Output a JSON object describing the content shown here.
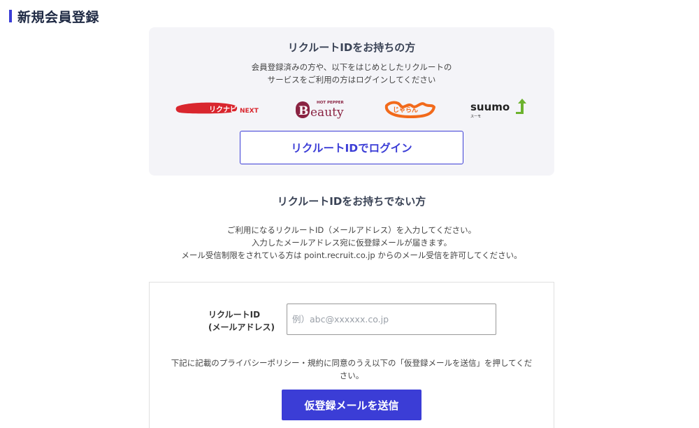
{
  "page": {
    "heading": "新規会員登録"
  },
  "login_section": {
    "title": "リクルートIDをお持ちの方",
    "description_line1": "会員登録済みの方や、以下をはじめとしたリクルートの",
    "description_line2": "サービスをご利用の方はログインしてください",
    "logos": [
      {
        "name": "rikunabi-next-logo",
        "text": "リクナビ",
        "suffix": "NEXT",
        "color": "#d9262e"
      },
      {
        "name": "hotpepper-beauty-logo",
        "small_text": "HOT PEPPER",
        "text": "eauty",
        "initial": "B",
        "color": "#8a2342"
      },
      {
        "name": "jalan-logo",
        "text": "じゃらん",
        "color": "#f26a1b"
      },
      {
        "name": "suumo-logo",
        "text": "suumo",
        "small_text": "スーモ",
        "color": "#222222",
        "accent": "#6cb22e"
      }
    ],
    "login_button_label": "リクルートIDでログイン"
  },
  "register_section": {
    "title": "リクルートIDをお持ちでない方",
    "description_line1": "ご利用になるリクルートID（メールアドレス）を入力してください。",
    "description_line2": "入力したメールアドレス宛に仮登録メールが届きます。",
    "description_line3": "メール受信制限をされている方は point.recruit.co.jp からのメール受信を許可してください。",
    "form": {
      "label_line1": "リクルートID",
      "label_line2": "(メールアドレス)",
      "email_value": "",
      "email_placeholder": "例）abc@xxxxxx.co.jp",
      "privacy_line1": "下記に記載のプライバシーポリシー・規約に同意のうえ以下の「仮登録メールを送信」を押してくだ",
      "privacy_line2": "さい。",
      "send_button_label": "仮登録メールを送信"
    }
  },
  "colors": {
    "accent": "#3b3dd6",
    "panel_background": "#f4f4f8"
  }
}
